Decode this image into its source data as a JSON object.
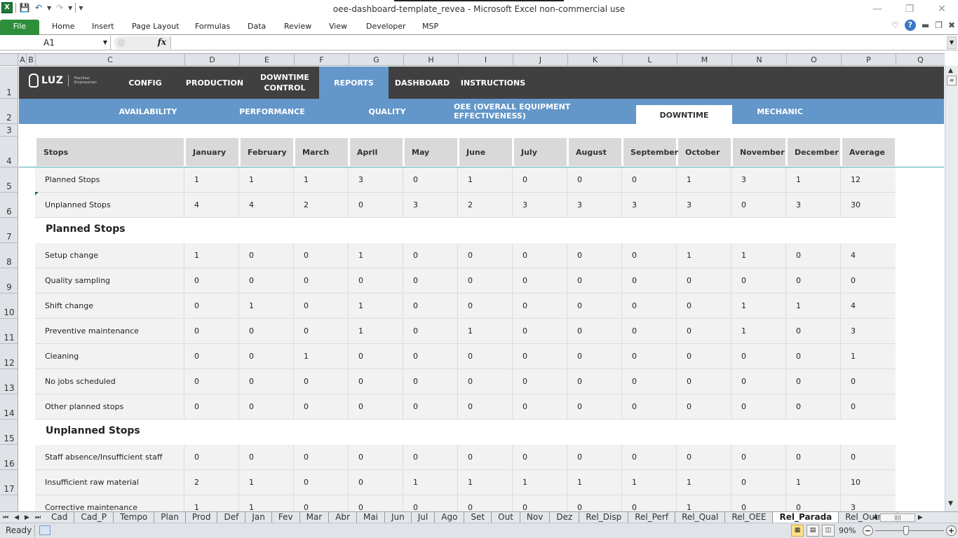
{
  "window": {
    "title": "oee-dashboard-template_revea  -  Microsoft Excel non-commercial use",
    "controls": [
      "minimize",
      "restore",
      "close"
    ]
  },
  "quick_access": {
    "icons": [
      "excel-icon",
      "save-icon",
      "undo-icon",
      "redo-icon",
      "customize-icon"
    ]
  },
  "ribbon": {
    "tabs": [
      "File",
      "Home",
      "Insert",
      "Page Layout",
      "Formulas",
      "Data",
      "Review",
      "View",
      "Developer",
      "MSP"
    ]
  },
  "formula_bar": {
    "name_box": "A1",
    "fx_label": "fx",
    "formula": ""
  },
  "columns": [
    "A",
    "B",
    "C",
    "D",
    "E",
    "F",
    "G",
    "H",
    "I",
    "J",
    "K",
    "L",
    "M",
    "N",
    "O",
    "P",
    "Q"
  ],
  "rows": [
    "1",
    "2",
    "3",
    "4",
    "5",
    "6",
    "7",
    "8",
    "9",
    "10",
    "11",
    "12",
    "13",
    "14",
    "15",
    "16",
    "17",
    ""
  ],
  "brand": {
    "logo_text": "LUZ",
    "logo_sub": "Planilhas Empresariais",
    "nav_color": "#404040",
    "accent_color": "#6396c9"
  },
  "main_nav": [
    {
      "label": "CONFIG",
      "active": false
    },
    {
      "label": "PRODUCTION",
      "active": false
    },
    {
      "label": "DOWNTIME CONTROL",
      "active": false
    },
    {
      "label": "REPORTS",
      "active": true
    },
    {
      "label": "DASHBOARD",
      "active": false
    },
    {
      "label": "INSTRUCTIONS",
      "active": false
    }
  ],
  "sub_nav": [
    {
      "label": "AVAILABILITY",
      "active": false
    },
    {
      "label": "PERFORMANCE",
      "active": false
    },
    {
      "label": "QUALITY",
      "active": false
    },
    {
      "label": "OEE (OVERALL EQUIPMENT  EFFECTIVENESS)",
      "active": false
    },
    {
      "label": "DOWNTIME",
      "active": true
    },
    {
      "label": "MECHANIC",
      "active": false
    }
  ],
  "table": {
    "headers": [
      "Stops",
      "January",
      "February",
      "March",
      "April",
      "May",
      "June",
      "July",
      "August",
      "September",
      "October",
      "November",
      "December",
      "Average"
    ],
    "summary_rows": [
      {
        "label": "Planned Stops",
        "values": [
          "1",
          "1",
          "1",
          "3",
          "0",
          "1",
          "0",
          "0",
          "0",
          "1",
          "3",
          "1",
          "12"
        ]
      },
      {
        "label": "Unplanned Stops",
        "values": [
          "4",
          "4",
          "2",
          "0",
          "3",
          "2",
          "3",
          "3",
          "3",
          "3",
          "0",
          "3",
          "30"
        ]
      }
    ],
    "planned_title": "Planned Stops",
    "planned_rows": [
      {
        "label": "Setup change",
        "values": [
          "1",
          "0",
          "0",
          "1",
          "0",
          "0",
          "0",
          "0",
          "0",
          "1",
          "1",
          "0",
          "4"
        ]
      },
      {
        "label": "Quality sampling",
        "values": [
          "0",
          "0",
          "0",
          "0",
          "0",
          "0",
          "0",
          "0",
          "0",
          "0",
          "0",
          "0",
          "0"
        ]
      },
      {
        "label": "Shift change",
        "values": [
          "0",
          "1",
          "0",
          "1",
          "0",
          "0",
          "0",
          "0",
          "0",
          "0",
          "1",
          "1",
          "4"
        ]
      },
      {
        "label": "Preventive maintenance",
        "values": [
          "0",
          "0",
          "0",
          "1",
          "0",
          "1",
          "0",
          "0",
          "0",
          "0",
          "1",
          "0",
          "3"
        ]
      },
      {
        "label": "Cleaning",
        "values": [
          "0",
          "0",
          "1",
          "0",
          "0",
          "0",
          "0",
          "0",
          "0",
          "0",
          "0",
          "0",
          "1"
        ]
      },
      {
        "label": "No jobs scheduled",
        "values": [
          "0",
          "0",
          "0",
          "0",
          "0",
          "0",
          "0",
          "0",
          "0",
          "0",
          "0",
          "0",
          "0"
        ]
      },
      {
        "label": "Other planned stops",
        "values": [
          "0",
          "0",
          "0",
          "0",
          "0",
          "0",
          "0",
          "0",
          "0",
          "0",
          "0",
          "0",
          "0"
        ]
      }
    ],
    "unplanned_title": "Unplanned Stops",
    "unplanned_rows": [
      {
        "label": "Staff absence/Insufficient staff",
        "values": [
          "0",
          "0",
          "0",
          "0",
          "0",
          "0",
          "0",
          "0",
          "0",
          "0",
          "0",
          "0",
          "0"
        ]
      },
      {
        "label": "Insufficient raw material",
        "values": [
          "2",
          "1",
          "0",
          "0",
          "1",
          "1",
          "1",
          "1",
          "1",
          "1",
          "0",
          "1",
          "10"
        ]
      },
      {
        "label": "Corrective maintenance",
        "values": [
          "1",
          "1",
          "0",
          "0",
          "0",
          "0",
          "0",
          "0",
          "0",
          "1",
          "0",
          "0",
          "3"
        ]
      }
    ]
  },
  "sheet_tabs": [
    "Cad",
    "Cad_P",
    "Tempo",
    "Plan",
    "Prod",
    "Def",
    "Jan",
    "Fev",
    "Mar",
    "Abr",
    "Mai",
    "Jun",
    "Jul",
    "Ago",
    "Set",
    "Out",
    "Nov",
    "Dez",
    "Rel_Disp",
    "Rel_Perf",
    "Rel_Qual",
    "Rel_OEE",
    "Rel_Parada",
    "Rel_Outros"
  ],
  "active_sheet": "Rel_Parada",
  "status": {
    "ready": "Ready",
    "zoom": "90%",
    "zoom_percent": 90
  }
}
